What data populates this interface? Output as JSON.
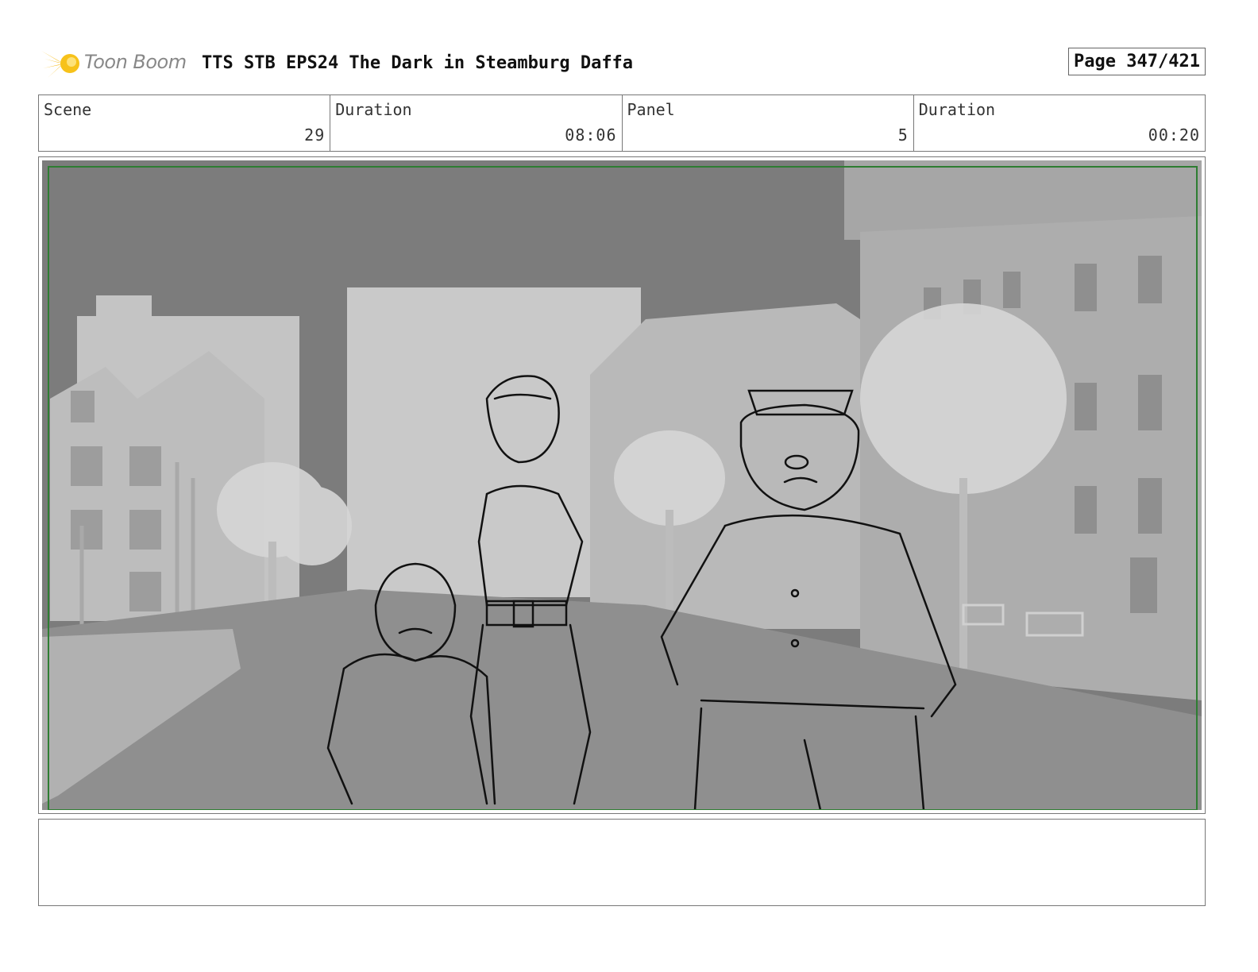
{
  "header": {
    "logo_text": "Toon Boom",
    "logo_icon": "starburst-icon",
    "title": "TTS STB EPS24 The Dark in Steamburg Daffa",
    "page": "Page 347/421"
  },
  "info": {
    "scene_label": "Scene",
    "scene_value": "29",
    "scene_duration_label": "Duration",
    "scene_duration_value": "08:06",
    "panel_label": "Panel",
    "panel_value": "5",
    "panel_duration_label": "Duration",
    "panel_duration_value": "00:20"
  },
  "colors": {
    "logo_accent": "#f5b400",
    "safe_frame": "#2e7d32",
    "sky": "#7c7c7c",
    "street": "#8f8f8f"
  },
  "notes": {
    "text": ""
  }
}
